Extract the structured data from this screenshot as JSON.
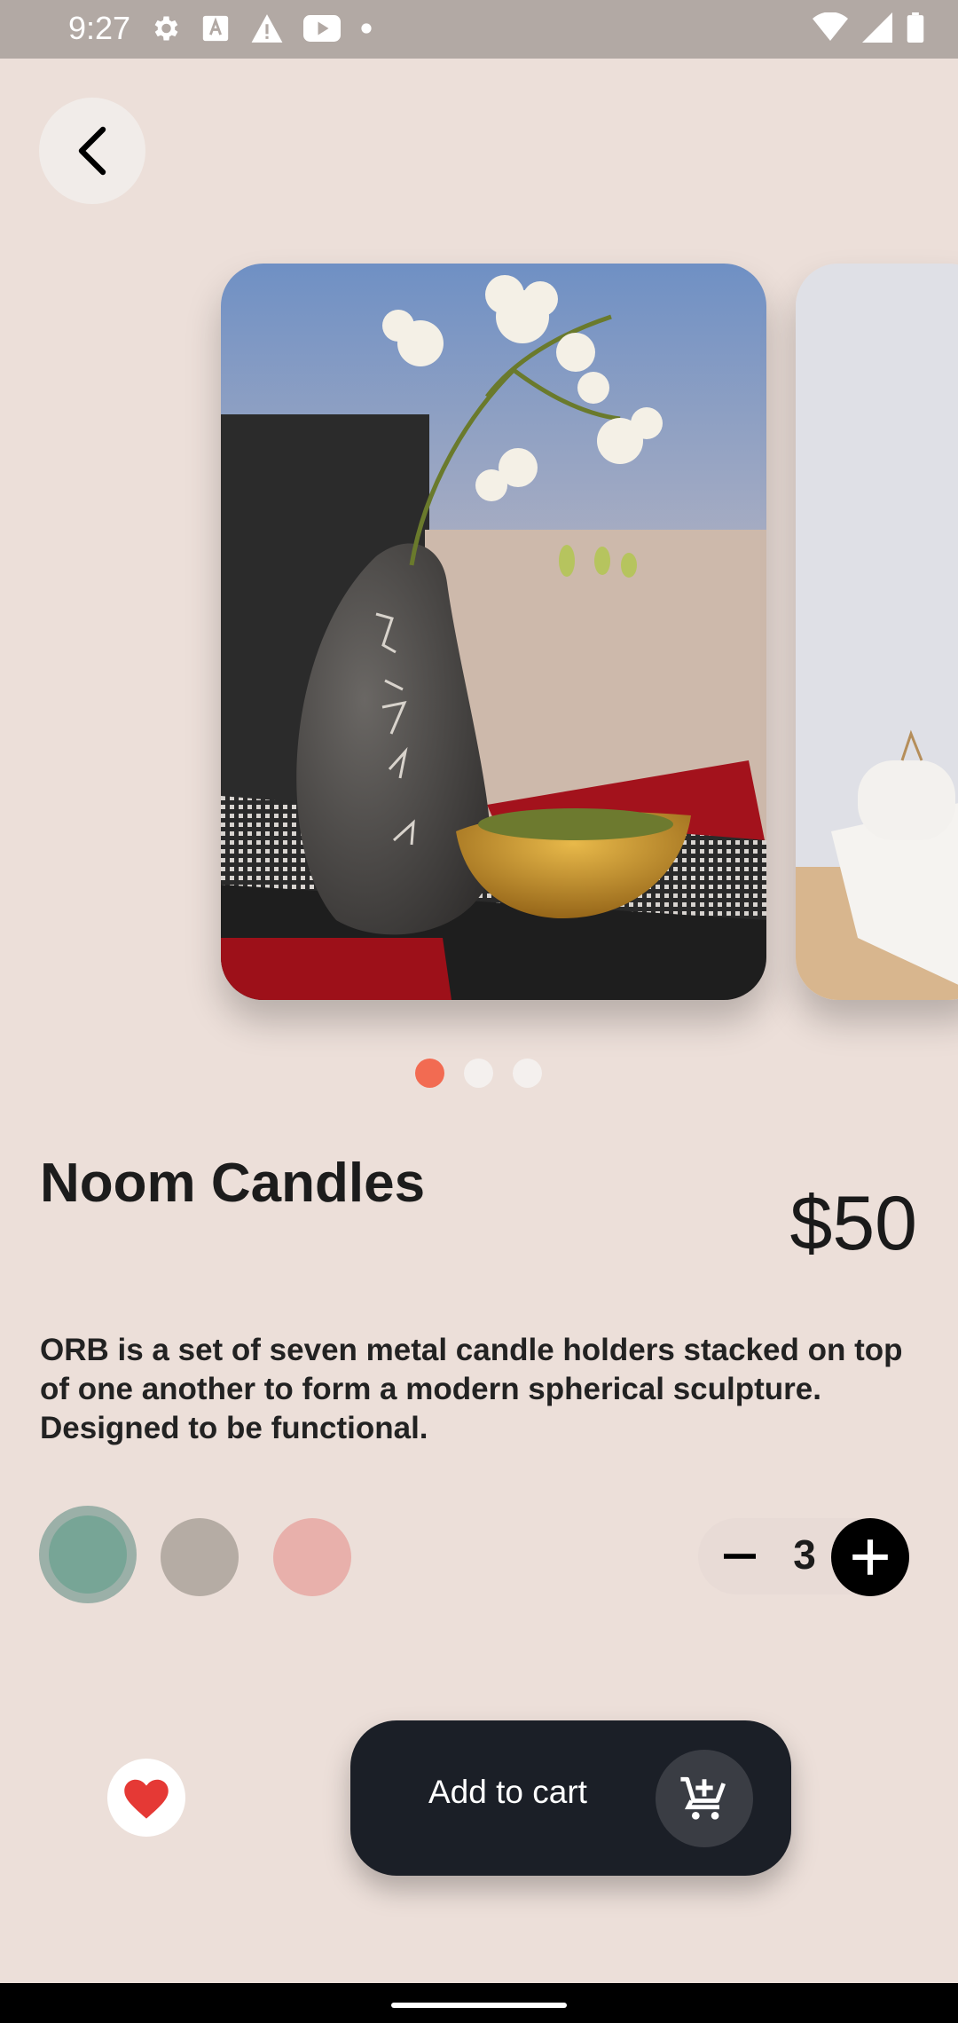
{
  "status_bar": {
    "time": "9:27",
    "left_icons": [
      "gear-icon",
      "text-a-icon",
      "warning-icon",
      "youtube-icon",
      "dot-icon"
    ],
    "right_icons": [
      "wifi-icon",
      "signal-icon",
      "battery-icon"
    ]
  },
  "nav": {
    "back_icon": "chevron-left-icon"
  },
  "carousel": {
    "image_count": 3,
    "active_index": 0
  },
  "product": {
    "title": "Noom Candles",
    "price": "$50",
    "description": "ORB is a set of seven metal candle holders stacked on top of one another to form a modern spherical sculpture. Designed to be functional."
  },
  "colors": {
    "options": [
      "#77a596",
      "#b5aca4",
      "#e8b0ab"
    ],
    "selected_index": 0
  },
  "quantity": {
    "value": "3"
  },
  "actions": {
    "favorite_icon": "heart-icon",
    "add_to_cart_label": "Add to cart",
    "cart_icon": "cart-plus-icon"
  },
  "theme": {
    "accent": "#f26b52",
    "dark": "#1b1f27",
    "background": "#ecdfd9"
  }
}
